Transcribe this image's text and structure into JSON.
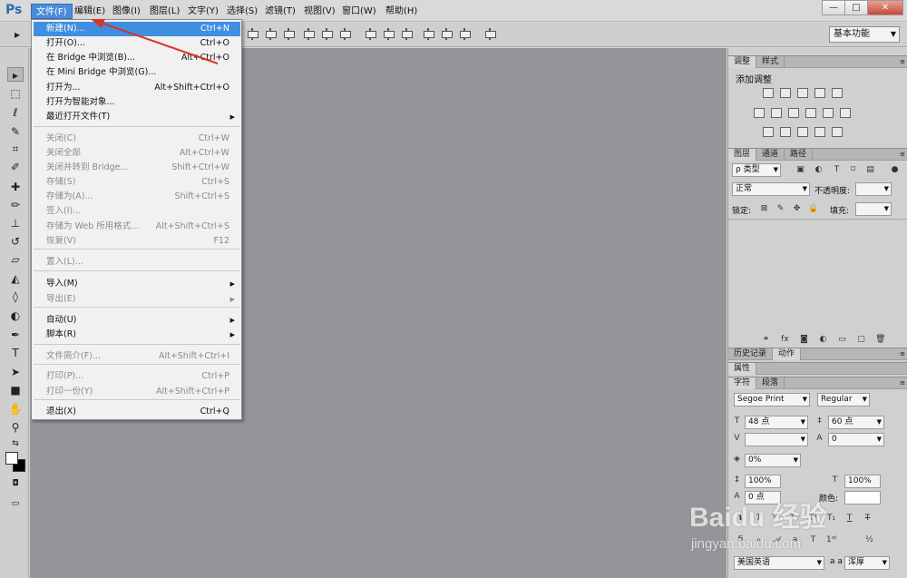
{
  "app": {
    "logo": "Ps"
  },
  "menubar": {
    "items": [
      "文件(F)",
      "编辑(E)",
      "图像(I)",
      "图层(L)",
      "文字(Y)",
      "选择(S)",
      "滤镜(T)",
      "视图(V)",
      "窗口(W)",
      "帮助(H)"
    ],
    "active_index": 0
  },
  "window_controls": {
    "minimize": "—",
    "maximize": "□",
    "close": "✕"
  },
  "options_bar": {
    "workspace": "基本功能"
  },
  "file_menu": {
    "items": [
      {
        "label": "新建(N)...",
        "shortcut": "Ctrl+N",
        "state": "highlighted"
      },
      {
        "label": "打开(O)...",
        "shortcut": "Ctrl+O",
        "state": "enabled"
      },
      {
        "label": "在 Bridge 中浏览(B)...",
        "shortcut": "Alt+Ctrl+O",
        "state": "enabled"
      },
      {
        "label": "在 Mini Bridge 中浏览(G)...",
        "shortcut": "",
        "state": "enabled"
      },
      {
        "label": "打开为...",
        "shortcut": "Alt+Shift+Ctrl+O",
        "state": "enabled"
      },
      {
        "label": "打开为智能对象...",
        "shortcut": "",
        "state": "enabled"
      },
      {
        "label": "最近打开文件(T)",
        "shortcut": "",
        "state": "enabled",
        "submenu": true
      },
      {
        "label": "关闭(C)",
        "shortcut": "Ctrl+W",
        "state": "disabled"
      },
      {
        "label": "关闭全部",
        "shortcut": "Alt+Ctrl+W",
        "state": "disabled"
      },
      {
        "label": "关闭并转到 Bridge...",
        "shortcut": "Shift+Ctrl+W",
        "state": "disabled"
      },
      {
        "label": "存储(S)",
        "shortcut": "Ctrl+S",
        "state": "disabled"
      },
      {
        "label": "存储为(A)...",
        "shortcut": "Shift+Ctrl+S",
        "state": "disabled"
      },
      {
        "label": "签入(I)...",
        "shortcut": "",
        "state": "disabled"
      },
      {
        "label": "存储为 Web 所用格式...",
        "shortcut": "Alt+Shift+Ctrl+S",
        "state": "disabled"
      },
      {
        "label": "恢复(V)",
        "shortcut": "F12",
        "state": "disabled"
      },
      {
        "label": "置入(L)...",
        "shortcut": "",
        "state": "disabled"
      },
      {
        "label": "导入(M)",
        "shortcut": "",
        "state": "enabled",
        "submenu": true
      },
      {
        "label": "导出(E)",
        "shortcut": "",
        "state": "disabled",
        "submenu": true
      },
      {
        "label": "自动(U)",
        "shortcut": "",
        "state": "enabled",
        "submenu": true
      },
      {
        "label": "脚本(R)",
        "shortcut": "",
        "state": "enabled",
        "submenu": true
      },
      {
        "label": "文件简介(F)...",
        "shortcut": "Alt+Shift+Ctrl+I",
        "state": "disabled"
      },
      {
        "label": "打印(P)...",
        "shortcut": "Ctrl+P",
        "state": "disabled"
      },
      {
        "label": "打印一份(Y)",
        "shortcut": "Alt+Shift+Ctrl+P",
        "state": "disabled"
      },
      {
        "label": "退出(X)",
        "shortcut": "Ctrl+Q",
        "state": "enabled"
      }
    ]
  },
  "adjustments_panel": {
    "tabs": [
      "调整",
      "样式"
    ],
    "title": "添加调整"
  },
  "layers_panel": {
    "tabs": [
      "图层",
      "通道",
      "路径"
    ],
    "filter_kind": "ρ 类型",
    "blend_mode": "正常",
    "opacity_label": "不透明度:",
    "lock_label": "锁定:",
    "fill_label": "填充:"
  },
  "history_panel": {
    "tabs": [
      "历史记录",
      "动作"
    ]
  },
  "properties_panel": {
    "tabs": [
      "属性"
    ]
  },
  "character_panel": {
    "tabs": [
      "字符",
      "段落"
    ],
    "font_family": "Segoe Print",
    "font_style": "Regular",
    "font_size": "48 点",
    "leading": "60 点",
    "kerning": "",
    "tracking": "0",
    "scale_percent": "0%",
    "vertical_scale": "100%",
    "horizontal_scale": "100%",
    "baseline_shift": "0 点",
    "color_label": "颜色:",
    "language": "美国英语",
    "anti_alias": "浑厚"
  },
  "watermark": {
    "brand": "Baidu 经验",
    "url": "jingyan.baidu.com"
  },
  "colors": {
    "canvas": "#959498",
    "menu_highlight": "#3f8fe0",
    "annotation": "#d9342b"
  }
}
